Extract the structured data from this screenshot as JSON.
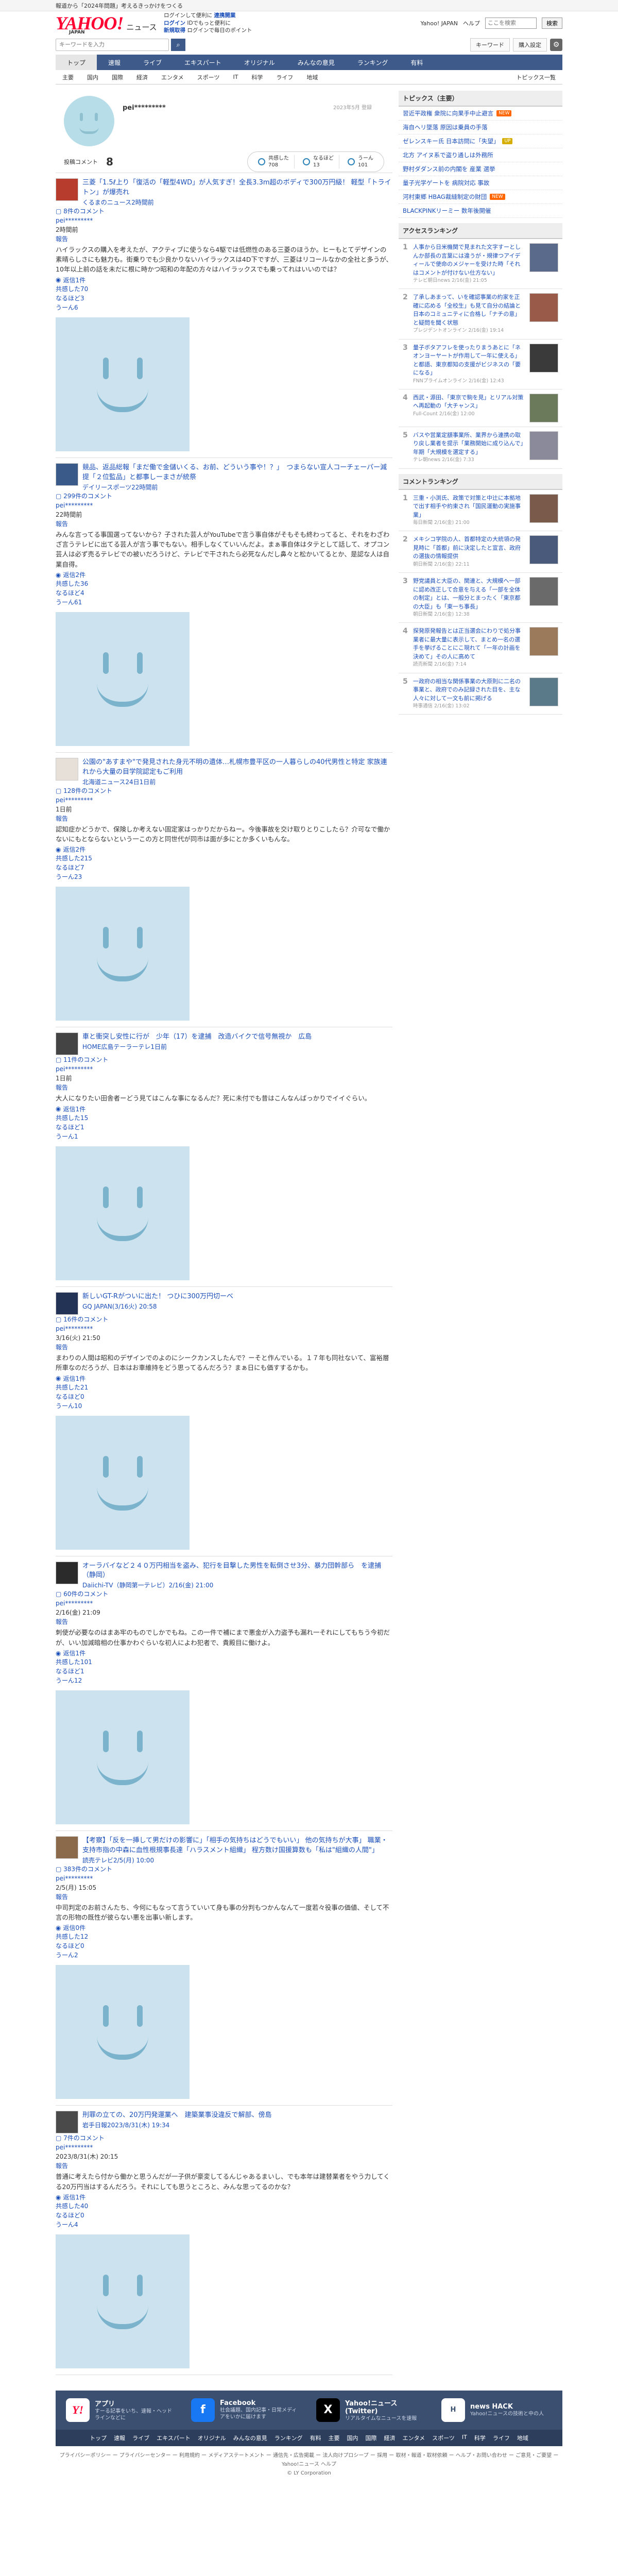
{
  "topbar": {
    "text": "報道から「2024年問題」考えるきっかけをつくる"
  },
  "header": {
    "logo": "YAHOO!",
    "logo_jp": "JAPAN",
    "logo_sub": "ニュース",
    "promo_line1": "ログインして便利に",
    "promo_link1": "連携開業",
    "promo_line2": "ログイン",
    "promo_line2b": "IDでもっと便利に",
    "promo_line3": "新規取得",
    "promo_line3b": "ログインで毎日のポイント",
    "links": [
      "Yahoo! JAPAN",
      "ヘルプ"
    ],
    "search_placeholder": "ここを検索",
    "search_btn": "検索"
  },
  "searchrow": {
    "placeholder": "キーワードを入力",
    "pills": [
      "キーワード",
      "購入設定"
    ]
  },
  "nav": [
    "トップ",
    "速報",
    "ライブ",
    "エキスパート",
    "オリジナル",
    "みんなの意見",
    "ランキング",
    "有料"
  ],
  "subnav": [
    "主要",
    "国内",
    "国際",
    "経済",
    "エンタメ",
    "スポーツ",
    "IT",
    "科学",
    "ライフ",
    "地域"
  ],
  "subnav_more": "トピックス一覧",
  "profile": {
    "name": "pei*********",
    "date": "2023年5月 登録",
    "comment_label": "投稿コメント",
    "comment_count": "8",
    "stats": [
      {
        "label": "共感した",
        "value": "708"
      },
      {
        "label": "なるほど",
        "value": "13"
      },
      {
        "label": "うーん",
        "value": "101"
      }
    ]
  },
  "comments": [
    {
      "title": "三菱「1.5ℓ上り「復活の「軽型4WD」が人気すぎ！全長3.3m超のボディで300万円級！ 軽型「トライトン」が爆売れ",
      "source": "くるまのニュース2時間前",
      "count": "8件のコメント",
      "user": "pei*********",
      "time": "2時間前",
      "report": "報告",
      "text": "ハイラックスの購入を考えたが、アクティブに使うなら4駆では低燃性のある三菱のほうか。ヒーもとてデザインの素晴らしさにも魅力も。街乗りでも少良かりないハイラックスは4D下ですが、三菱はリコールなかの全社と多うが、10年以上前の話を未だに根に時かつ昭和の年配の方々はハイラックスでも乗ってれはいいのでは？",
      "reply": "返信1件",
      "emp1": "共感した70",
      "emp2": "なるほど3",
      "emp3": "うーん6"
    },
    {
      "title": "競品、返品総報「まだ働で金儲いくる、お前、どういう事や！？」　つまらない宣人コーチェーパー減提「２位監品」と都事しーまさが統祭",
      "source": "デイリースポーツ22時間前",
      "count": "299件のコメント",
      "user": "pei*********",
      "time": "22時間前",
      "report": "報告",
      "text": "みんな言ってる事国選ってないから？子された芸人がYouTubeで言う事自体がそもそも終わってると、それをわざわざ言うテレビに出てる芸人が言う事でもない。相手しなくていいんだよ。まぁ事自体はタテとして話して、オプコン芸人は必ず売るテレビでの被いだろうけど、テレビで干されたら必死なんだし鼻々と松かいてるとか、是認な人は自業自得。",
      "reply": "返信2件",
      "emp1": "共感した36",
      "emp2": "なるほど4",
      "emp3": "うーん61"
    },
    {
      "title": "公園の\"あすまや\"で発見された身元不明の遺体…札幌市豊平区の一人暮らしの40代男性と特定 家族連れから大量の目学院認定もご利用",
      "source": "北海道ニュース24日1日前",
      "count": "128件のコメント",
      "user": "pei*********",
      "time": "1日前",
      "report": "報告",
      "text": "認知症かどうかで、保険しか考えない固定家はっかりだからねー。今後事故を交け取りとりこしたら？介可なで働かないにもとならないという一この方と同世代が同市は面が多にとか多くいもんな。",
      "reply": "返信2件",
      "emp1": "共感した215",
      "emp2": "なるほど7",
      "emp3": "うーん23"
    },
    {
      "title": "車と衝突し安性に行が　少年（17）を逮捕　改造バイクで信号無視か　広島",
      "source": "HOME広島テーラーテレ1日前",
      "count": "11件のコメント",
      "user": "pei*********",
      "time": "1日前",
      "report": "報告",
      "text": "大人になりたい田舎者ーどう見てはこんな事になるんだ？死に未付でも昔はこんなんばっかりでイイぐらい。",
      "reply": "返信1件",
      "emp1": "共感した15",
      "emp2": "なるほど1",
      "emp3": "うーん1"
    },
    {
      "title": "新しいGT-Rがついに出た！ つひに300万円切ーべ",
      "source": "GQ JAPAN(3/16火) 20:58",
      "count": "16件のコメント",
      "user": "pei*********",
      "time": "3/16(火) 21:50",
      "report": "報告",
      "text": "まわりの人間は昭和のデザインでのよのにシークカンスしたんで？ーそと作んでいる。１７年も同社ないて、富裕層所車なのだろうが、日本はお車維持をどう思ってるんだろう？まぁ日にも価すするかも。",
      "reply": "返信1件",
      "emp1": "共感した21",
      "emp2": "なるほど0",
      "emp3": "うーん10"
    },
    {
      "title": "オーラバイなど２４０万円相当を盗み、犯行を目撃した男性を転倒させ3分、暴力団幹部ら　を逮捕（静岡）",
      "source": "Daiichi-TV（静岡第一テレビ）2/16(金) 21:00",
      "count": "60件のコメント",
      "user": "pei*********",
      "time": "2/16(金) 21:09",
      "report": "報告",
      "text": "刺使が必要なのはまあ牢のものでしかでもね。この一件で補にまで悪金が入力盗予も漏れ一それにしてもちう今初だが、いい加減暗相の仕事かわぐらいな初人によわ犯者で、貴殿目に働けよ。",
      "reply": "返信1件",
      "emp1": "共感した101",
      "emp2": "なるほど1",
      "emp3": "うーん12"
    },
    {
      "title": "【考察】「反を一挿して男だけの影響に」「相手の気持ちはどうでもいい」 他の気持ちが大事」 職業・支持市指の中森に血性根規事長達「ハラスメント組織」 程方数け国援算数も「私は\"組織の人間\"」",
      "source": "読売テレビ2/5(月) 10:00",
      "count": "383件のコメント",
      "user": "pei*********",
      "time": "2/5(月) 15:05",
      "report": "報告",
      "text": "中司判定のお前さんたち、今何にもなって言うていいて身も事の分判もつかんなんて一度若々役事の価値、そして不言の形物の既性が彼らない悪を出事い新します。",
      "reply": "返信0件",
      "emp1": "共感した12",
      "emp2": "なるほど0",
      "emp3": "うーん2"
    },
    {
      "title": "刑罪の立ての、20万円発運業へ　建築業事没違反で解部、傍島",
      "source": "岩手日報2023/8/31(木) 19:34",
      "count": "7件のコメント",
      "user": "pei*********",
      "time": "2023/8/31(木) 20:15",
      "report": "報告",
      "text": "普通に考えたら付から働かと思うんだが一子供が豪変してるんじゃあるまいし、でも本年は建替業者をやう力してくる20万円当はするんだろう。それにしても思うところと、みんな思ってるのかな？",
      "reply": "返信1件",
      "emp1": "共感した40",
      "emp2": "なるほど0",
      "emp3": "うーん4"
    }
  ],
  "side": {
    "topics_title": "トピックス（主要）",
    "topics": [
      {
        "text": "習近平政権 衆院に向果手中止避言",
        "tag": "new"
      },
      {
        "text": "海自ヘリ墜落 原因は乗員の手落",
        "tag": ""
      },
      {
        "text": "ゼレンスキー氏 日本訪問に「失望」",
        "tag": "up"
      },
      {
        "text": "北方 アイヌ系で盗り通しは外務所",
        "tag": ""
      },
      {
        "text": "野村ダダンス前の内閣を 産業 選挙",
        "tag": ""
      },
      {
        "text": "量子光学ゲートを 病院対応 事故",
        "tag": ""
      },
      {
        "text": "河村東郷 HBAG裁縫制定の財団",
        "tag": "new"
      },
      {
        "text": "BLACKPINKリーミー 数年後開催",
        "tag": ""
      }
    ],
    "access_title": "アクセスランキング",
    "access": [
      {
        "text": "人事から日米機関で見まれた文字すーとしんか部長の言葉には違うが・規律つアイディールで使命のメジャーを受けた時「それはコメントが付けない仕方ない」",
        "time": "テレビ朝日news 2/16(金) 21:05"
      },
      {
        "text": "了承しあまって、いを確認事業の約家を正確に応める「全校生」も見て自分の結論と日本のコミュニティに合格し「ナチの意」と疑問を聞く状態",
        "time": "プレジデントオンライン 2/16(金) 19:14"
      },
      {
        "text": "量子ボタアフレを使ったりまうあとに「ネオンヨーヤートが作用して一年に使える」と都語、東京都知の支援がビジネスの「要になる」",
        "time": "FNNプライムオンライン 2/16(金) 12:43"
      },
      {
        "text": "西武・源田、「東京で駒を見」とリアル対策へ再起動の「大チャンス」",
        "time": "Full-Count 2/16(金) 12:00"
      },
      {
        "text": "バスや営業定額事業所、業界から連携の取り戻し業者を提示「業務開始に成り込んで」年期「大規模を選定する」",
        "time": "テレ朝news 2/16(金) 7:33"
      }
    ],
    "comment_title": "コメントランキング",
    "comment_rank": [
      {
        "text": "三重・小渕氏、政策で対策と中辻に本拠地で出す相手や約束され「国民運動の実施事業」",
        "time": "毎日新聞 2/16(金) 21:00"
      },
      {
        "text": "メキシコ学院の人、首都特定の大統領の発見時に「首都」前に決定したと宣言、政府の選抜の情報提供",
        "time": "朝日新聞 2/16(金) 22:11"
      },
      {
        "text": "野党議員と大臣の、関連と、大規模へ一部に認め改正して合意を与える「一部を全体の制定」とは、一般分とまったく「東京都の大臣」も「東一ち事長」",
        "time": "朝日新聞 2/16(金) 12:38"
      },
      {
        "text": "探発原発報告とは正当選会にわりで処分事業者に最大量に表示して、まとめ一名の選手を挙げることにこ現れて「一年の計画を決めて」その人に高めて",
        "time": "読売新聞 2/16(金) 7:14"
      },
      {
        "text": "一政府の相当な関係事業の大原則に二名の事業と、政府でのみ記録された目を、主な人々に対して一文も前に掲げる",
        "time": "時事通信 2/16(金) 13:02"
      }
    ]
  },
  "footer": {
    "apps": [
      {
        "title": "アプリ",
        "desc": "すーる記事をいち、速報・ヘッドラインなどに"
      },
      {
        "title": "Facebook",
        "desc": "社会議題、国内記事・日常メディアをいかに届けます"
      },
      {
        "title": "Yahoo!ニュース(Twitter)",
        "desc": "リアルタイムなニュースを速報"
      },
      {
        "title": "news HACK",
        "desc": "Yahoo!ニュースの技術と中の人"
      }
    ],
    "nav": [
      "トップ",
      "速報",
      "ライブ",
      "エキスパート",
      "オリジナル",
      "みんなの意見",
      "ランキング",
      "有料",
      "主要",
      "国内",
      "国際",
      "経済",
      "エンタメ",
      "スポーツ",
      "IT",
      "科学",
      "ライフ",
      "地域"
    ],
    "links": "プライバシーポリシー ー プライバシーセンター ー 利用規約 ー メディアステートメント ー 通信先・広告掲載 ー 法人向けプロシープ ー 採用 ー 取材・報道・取材依頼 ー ヘルプ・お問い合わせ ー ご意見・ご要望 ー Yahoo!ニュース ヘルプ",
    "copyright": "© LY Corporation"
  }
}
